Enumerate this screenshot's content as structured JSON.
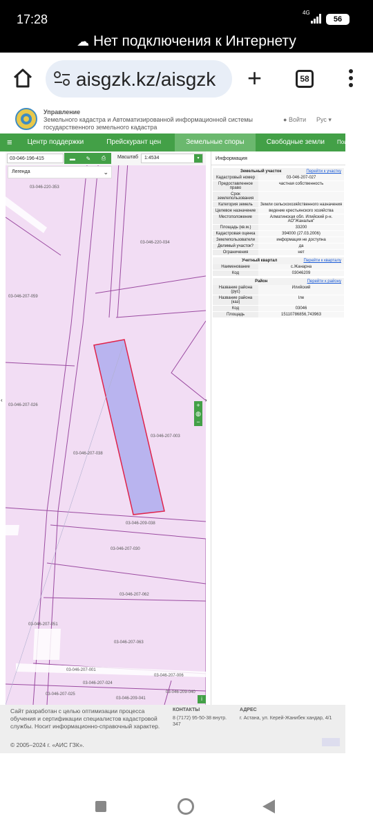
{
  "status": {
    "time": "17:28",
    "network": "4G",
    "battery": "56"
  },
  "offline_banner": "Нет подключения к Интернету",
  "browser": {
    "url": "aisgzk.kz/aisgzk",
    "tabs_count": "58"
  },
  "site_header": {
    "title_line1": "Управление",
    "title_line2": "Земельного кадастра и Автоматизированной информационной системы",
    "title_line3": "государственного земельного кадастра",
    "login": "Войти",
    "lang": "Рус"
  },
  "menu": [
    "Центр поддержки",
    "Прейскурант цен",
    "Земельные споры",
    "Свободные земли",
    "Поис"
  ],
  "map_toolbar": {
    "search_value": "03-046-196-415",
    "scale_label": "Масштаб",
    "scale_value": "1:4534",
    "legend": "Легенда"
  },
  "map_labels": [
    {
      "text": "03-046-220-353"
    },
    {
      "text": "03-046-220-034"
    },
    {
      "text": "03-046-207-059"
    },
    {
      "text": "03-046-207-026"
    },
    {
      "text": "03-046-207-003"
    },
    {
      "text": "03-046-207-038"
    },
    {
      "text": "03-046-209-038"
    },
    {
      "text": "03-046-207-030"
    },
    {
      "text": "03-046-207-062"
    },
    {
      "text": "03-046-207-051"
    },
    {
      "text": "03-046-207-063"
    },
    {
      "text": "03-046-207-001"
    },
    {
      "text": "03-046-207-006"
    },
    {
      "text": "03-046-207-024"
    },
    {
      "text": "03-046-207-025"
    },
    {
      "text": "03-046-209-040"
    },
    {
      "text": "03-046-209-041"
    }
  ],
  "info": {
    "title": "Информация",
    "parcel_header": "Земельный участок",
    "parcel_link": "Перейти к участку",
    "parcel_rows": [
      {
        "k": "Кадастровый номер",
        "v": "03-046-207-027"
      },
      {
        "k": "Предоставленное право",
        "v": "частная собственность"
      },
      {
        "k": "Срок землепользования",
        "v": ""
      },
      {
        "k": "Категория земель",
        "v": "Земли сельскохозяйственного назначения"
      },
      {
        "k": "Целевое назначение",
        "v": "ведение крестьянского хозяйства"
      },
      {
        "k": "Местоположение",
        "v": "Алматинская обл. Илийский р-н. АО\"Жаналык\""
      },
      {
        "k": "Площадь (кв.м.)",
        "v": "33200"
      },
      {
        "k": "Кадастровая оценка",
        "v": "394000 (27.03.2006)"
      },
      {
        "k": "Землепользователи",
        "v": "информация не доступна"
      },
      {
        "k": "Делимый участок?",
        "v": "да"
      },
      {
        "k": "Ограничения",
        "v": "нет"
      }
    ],
    "quarter_header": "Учетный квартал",
    "quarter_link": "Перейти к кварталу",
    "quarter_rows": [
      {
        "k": "Наименование",
        "v": "с.Жанарна"
      },
      {
        "k": "Код",
        "v": "03046209"
      }
    ],
    "district_header": "Район",
    "district_link": "Перейти к району",
    "district_rows": [
      {
        "k": "Название района (рус)",
        "v": "Илийский"
      },
      {
        "k": "Название района (каз)",
        "v": "Іле"
      },
      {
        "k": "Код",
        "v": "03046"
      },
      {
        "k": "Площадь",
        "v": "15110786856,743963"
      }
    ]
  },
  "footer": {
    "about": "Сайт разработан с целью оптимизации процесса обучения и сертификации специалистов кадастровой службы. Носит информационно-справочный характер.",
    "copyright": "© 2005–2024 г. «АИС ГЗК».",
    "contacts_label": "КОНТАКТЫ",
    "phone": "8 (7172) 95-50-38 внутр. 347",
    "address_label": "АДРЕС",
    "address": "г. Астана, ул. Керей-Жанибек хандар, 4/1"
  },
  "colors": {
    "menu_green": "#43a047",
    "parcel_fill": "#b9b4ef",
    "parcel_stroke": "#e0224a",
    "map_bg": "#f2ddf4"
  }
}
